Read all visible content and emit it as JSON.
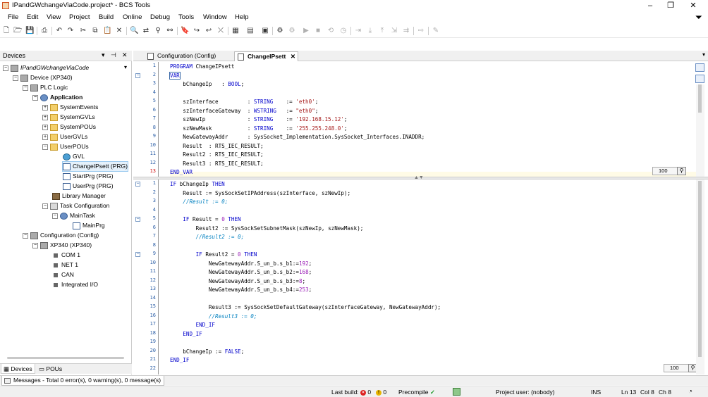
{
  "window": {
    "title": "IPandGWchangeViaCode.project* - BCS Tools",
    "minimize": "–",
    "maximize": "❐",
    "close": "✕"
  },
  "menu": [
    "File",
    "Edit",
    "View",
    "Project",
    "Build",
    "Online",
    "Debug",
    "Tools",
    "Window",
    "Help"
  ],
  "devices_panel": {
    "title": "Devices",
    "pin": "⊣",
    "close": "✕",
    "tree": [
      {
        "label": "IPandGWchangeViaCode",
        "italic": true
      },
      {
        "label": "Device (XP340)"
      },
      {
        "label": "PLC Logic"
      },
      {
        "label": "Application",
        "bold": true
      },
      {
        "label": "SystemEvents"
      },
      {
        "label": "SystemGVLs"
      },
      {
        "label": "SystemPOUs"
      },
      {
        "label": "UserGVLs"
      },
      {
        "label": "UserPOUs"
      },
      {
        "label": "GVL"
      },
      {
        "label": "ChangeIPsett (PRG)",
        "selected": true
      },
      {
        "label": "StartPrg (PRG)"
      },
      {
        "label": "UserPrg (PRG)"
      },
      {
        "label": "Library Manager"
      },
      {
        "label": "Task Configuration"
      },
      {
        "label": "MainTask"
      },
      {
        "label": "MainPrg"
      },
      {
        "label": "Configuration (Config)"
      },
      {
        "label": "XP340 (XP340)"
      },
      {
        "label": "COM 1"
      },
      {
        "label": "NET 1"
      },
      {
        "label": "CAN"
      },
      {
        "label": "Integrated I/O"
      }
    ],
    "tabs": [
      "Devices",
      "POUs"
    ]
  },
  "editor": {
    "tabs": [
      {
        "label": "Configuration (Config)"
      },
      {
        "label": "ChangeIPsett",
        "close": "✕"
      }
    ],
    "zoom_top": "100",
    "zoom_bottom": "100",
    "declaration_lines": [
      "PROGRAM ChangeIPsett",
      "VAR",
      "    bChangeIp   : BOOL;",
      "",
      "    szInterface         : STRING    := 'eth0';",
      "    szInterfaceGateway  : WSTRING   := \"eth0\";",
      "    szNewIp             : STRING    := '192.168.15.12';",
      "    szNewMask           : STRING    := '255.255.248.0';",
      "    NewGatewayAddr      : SysSocket_Implementation.SysSocket_Interfaces.INADDR;",
      "    Result  : RTS_IEC_RESULT;",
      "    Result2 : RTS_IEC_RESULT;",
      "    Result3 : RTS_IEC_RESULT;",
      "END_VAR"
    ],
    "implementation_lines": [
      "IF bChangeIp THEN",
      "    Result := SysSockSetIPAddress(szInterface, szNewIp);",
      "    //Result := 0;",
      "",
      "    IF Result = 0 THEN",
      "        Result2 := SysSockSetSubnetMask(szNewIp, szNewMask);",
      "        //Result2 := 0;",
      "",
      "        IF Result2 = 0 THEN",
      "            NewGatewayAddr.S_un_b.s_b1:=192;",
      "            NewGatewayAddr.S_un_b.s_b2:=168;",
      "            NewGatewayAddr.S_un_b.s_b3:=8;",
      "            NewGatewayAddr.S_un_b.s_b4:=253;",
      "",
      "            Result3 := SysSockSetDefaultGateway(szInterfaceGateway, NewGatewayAddr);",
      "            //Result3 := 0;",
      "        END_IF",
      "    END_IF",
      "",
      "    bChangeIp := FALSE;",
      "END_IF",
      ""
    ]
  },
  "messages_tab": "Messages - Total 0 error(s), 0 warning(s), 0 message(s)",
  "status": {
    "last_build_label": "Last build:",
    "errors": "0",
    "warnings": "0",
    "precompile_label": "Precompile",
    "precompile_check": "✓",
    "project_user": "Project user: (nobody)",
    "ins": "INS",
    "line": "Ln 13",
    "col": "Col 8",
    "ch": "Ch 8"
  },
  "colors": {
    "keyword": "#0000cc",
    "string": "#a31515",
    "number": "#9a1fb7",
    "comment": "#0080c0",
    "line_number": "#2b5ea6",
    "current_line_number": "#d21010"
  }
}
